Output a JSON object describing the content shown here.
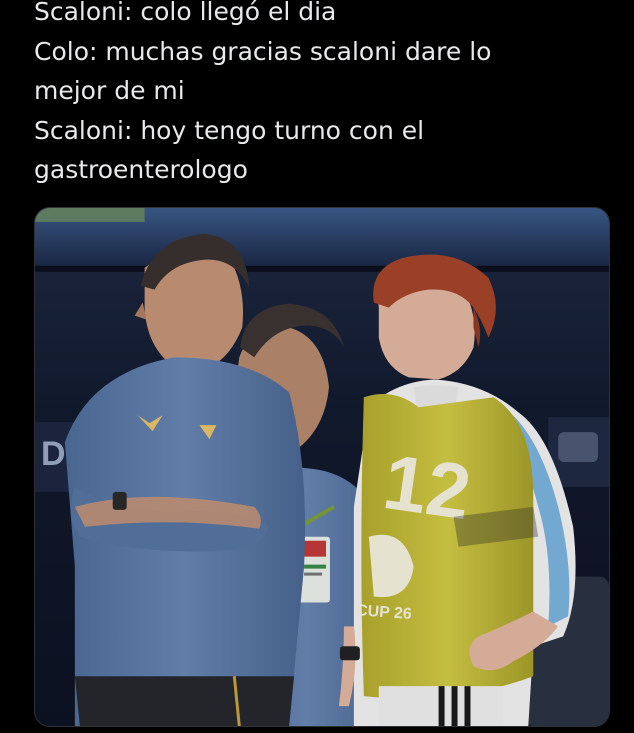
{
  "post": {
    "lines": [
      "Scaloni: colo llegó el dia",
      "Colo: muchas gracias scaloni dare lo",
      "mejor de mi",
      "Scaloni: hoy tengo turno con el",
      "gastroenterologo"
    ]
  },
  "media": {
    "bib_number": "12",
    "bib_text": "CUP 26",
    "stadium_board_text": "DI",
    "colors": {
      "shirt_blue": "#5f7fae",
      "bib_yellow": "#c9c23a",
      "hair_red": "#a3452a",
      "stadium_dark": "#141d33"
    }
  }
}
